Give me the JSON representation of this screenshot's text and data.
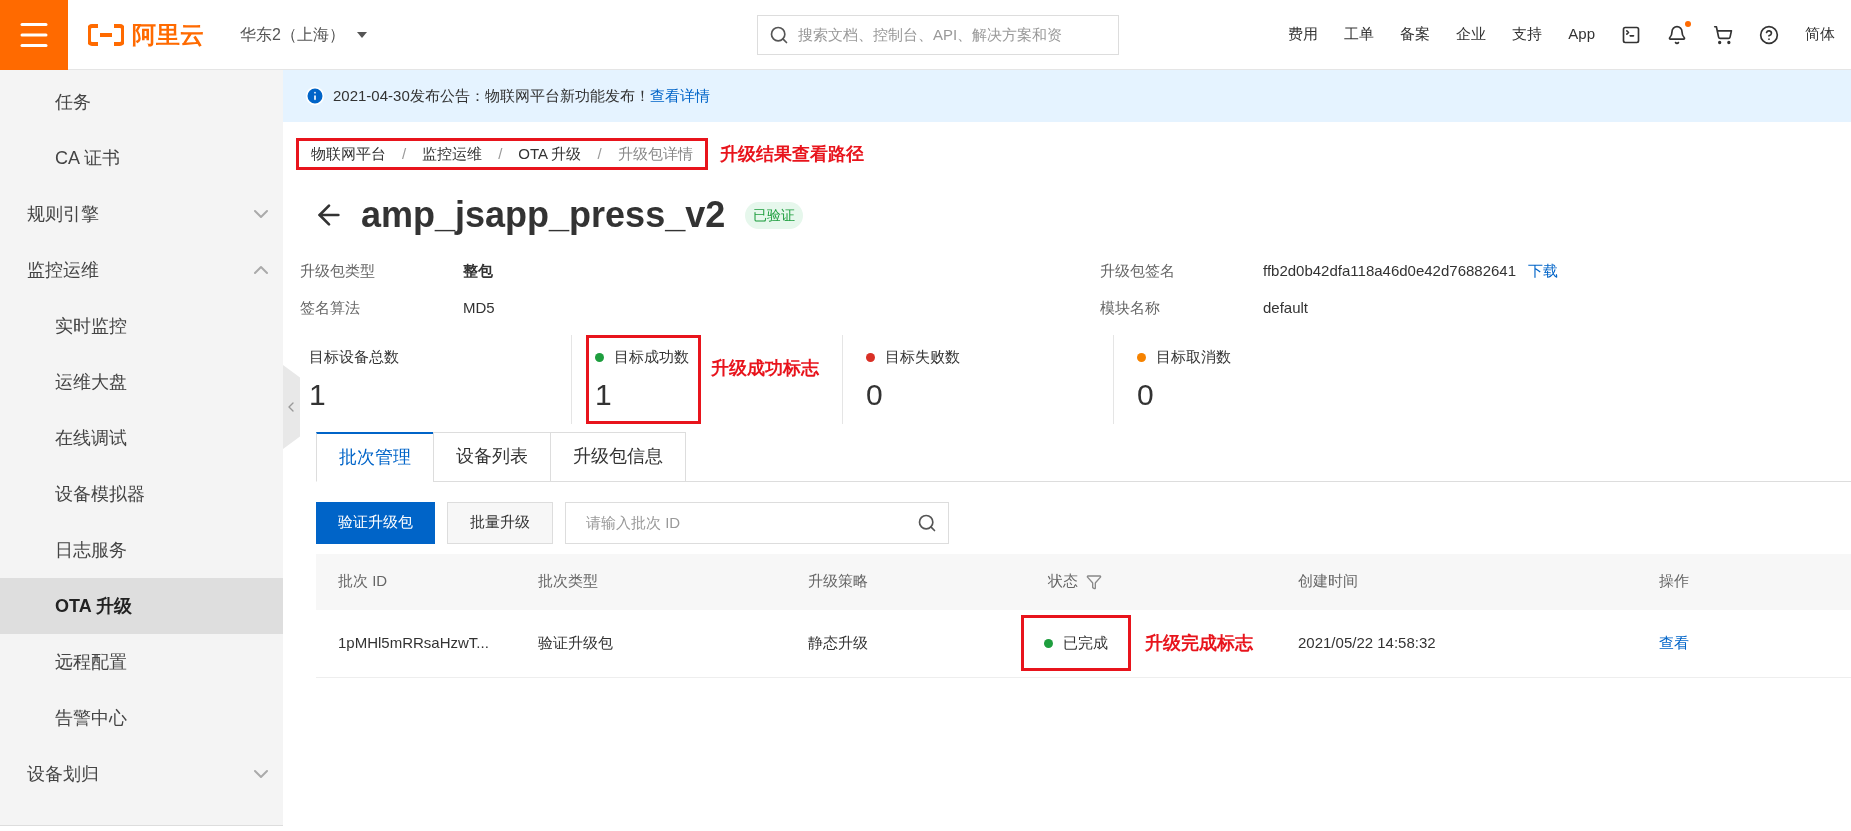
{
  "topbar": {
    "logo": "阿里云",
    "region": "华东2（上海）",
    "search": {
      "placeholder": "搜索文档、控制台、API、解决方案和资"
    },
    "links": [
      "费用",
      "工单",
      "备案",
      "企业",
      "支持",
      "App"
    ],
    "notification_dot": true,
    "language": "简体"
  },
  "sidebar": {
    "items": [
      {
        "label": "任务",
        "kind": "child",
        "selected": false
      },
      {
        "label": "CA 证书",
        "kind": "child",
        "selected": false
      },
      {
        "label": "规则引擎",
        "kind": "group",
        "expanded": false,
        "selected": false
      },
      {
        "label": "监控运维",
        "kind": "group",
        "expanded": true,
        "selected": false
      },
      {
        "label": "实时监控",
        "kind": "child",
        "selected": false
      },
      {
        "label": "运维大盘",
        "kind": "child",
        "selected": false
      },
      {
        "label": "在线调试",
        "kind": "child",
        "selected": false
      },
      {
        "label": "设备模拟器",
        "kind": "child",
        "selected": false
      },
      {
        "label": "日志服务",
        "kind": "child",
        "selected": false
      },
      {
        "label": "OTA 升级",
        "kind": "child",
        "selected": true
      },
      {
        "label": "远程配置",
        "kind": "child",
        "selected": false
      },
      {
        "label": "告警中心",
        "kind": "child",
        "selected": false
      },
      {
        "label": "设备划归",
        "kind": "group",
        "expanded": false,
        "selected": false
      }
    ]
  },
  "notice": {
    "text": "2021-04-30发布公告：物联网平台新功能发布！",
    "link": "查看详情"
  },
  "breadcrumb": {
    "items": [
      "物联网平台",
      "监控运维",
      "OTA 升级",
      "升级包详情"
    ],
    "separator": "/",
    "highlighted": true,
    "annotation": "升级结果查看路径"
  },
  "title": {
    "text": "amp_jsapp_press_v2",
    "badge": "已验证"
  },
  "info": [
    {
      "label": "升级包类型",
      "value": "整包",
      "bold": true
    },
    {
      "label": "升级包签名",
      "value": "ffb2d0b42dfa118a46d0e42d76882641",
      "link": "下载",
      "bold": false
    },
    {
      "label": "签名算法",
      "value": "MD5",
      "bold": false
    },
    {
      "label": "模块名称",
      "value": "default",
      "bold": false
    }
  ],
  "stats": [
    {
      "label": "目标设备总数",
      "value": "1"
    },
    {
      "label": "目标成功数",
      "value": "1",
      "color": "#1e9e3e",
      "highlighted": true,
      "annotation": "升级成功标志"
    },
    {
      "label": "目标失败数",
      "value": "0",
      "color": "#d93026"
    },
    {
      "label": "目标取消数",
      "value": "0",
      "color": "#f68300"
    }
  ],
  "tabs": [
    {
      "label": "批次管理",
      "selected": true
    },
    {
      "label": "设备列表",
      "selected": false
    },
    {
      "label": "升级包信息",
      "selected": false
    }
  ],
  "toolbar": {
    "primary": "验证升级包",
    "secondary": "批量升级",
    "search": {
      "placeholder": "请输入批次 ID"
    }
  },
  "table": {
    "columns": [
      "批次 ID",
      "批次类型",
      "升级策略",
      "状态",
      "创建时间",
      "操作"
    ],
    "rows": [
      {
        "batch_id": "1pMHl5mRRsaHzwT...",
        "type": "验证升级包",
        "strategy": "静态升级",
        "status": "已完成",
        "color": "#1e9e3e",
        "status_highlighted": true,
        "status_annotation": "升级完成标志",
        "created": "2021/05/22 14:58:32",
        "action": "查看"
      }
    ]
  }
}
